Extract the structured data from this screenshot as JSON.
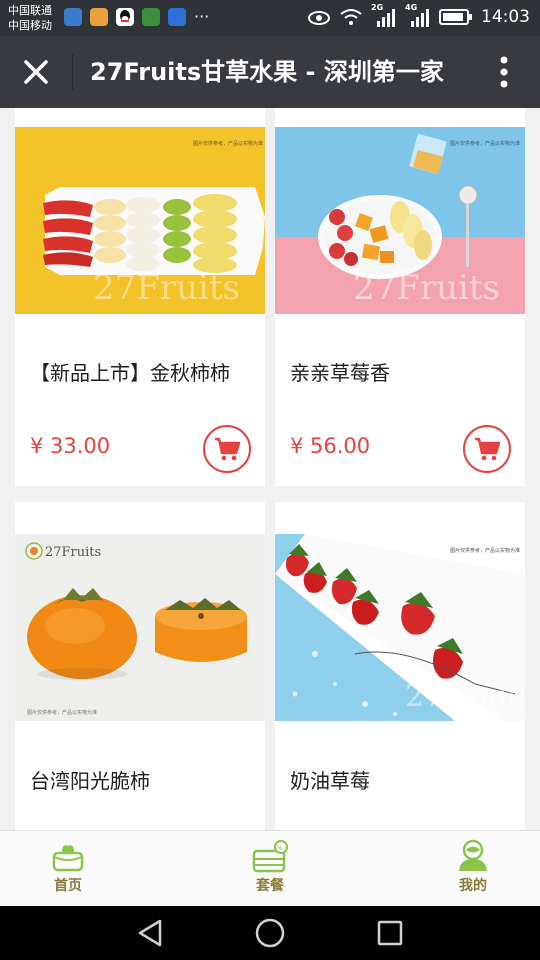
{
  "status_bar": {
    "carrier_1": "中国联通",
    "carrier_2": "中国移动",
    "network_1": "2G",
    "network_2": "4G",
    "time": "14:03",
    "more": "···"
  },
  "title_bar": {
    "title": "27Fruits甘草水果 - 深圳第一家"
  },
  "products": [
    {
      "name": "【新品上市】金秋柿柿",
      "price": "¥ 33.00",
      "watermark": "27Fruits",
      "caption": "图片仅供参考，产品以实物为准"
    },
    {
      "name": "亲亲草莓香",
      "price": "¥ 56.00",
      "watermark": "27Fruits",
      "caption": "图片仅供参考，产品以实物为准"
    },
    {
      "name": "台湾阳光脆柿",
      "price": "",
      "watermark": "27Fruits",
      "caption": "图片仅供参考，产品以实物为准"
    },
    {
      "name": "奶油草莓",
      "price": "",
      "watermark": "27Fruits",
      "caption": "图片仅供参考，产品以实物为准"
    }
  ],
  "tab_bar": {
    "tabs": [
      {
        "label": "首页",
        "icon": "home-gift-icon"
      },
      {
        "label": "套餐",
        "icon": "package-icon"
      },
      {
        "label": "我的",
        "icon": "profile-icon"
      }
    ]
  },
  "colors": {
    "price": "#e64340",
    "titlebar": "#393a3f",
    "tab_icon": "#8cc34a",
    "tab_label": "#8a7d3a"
  }
}
